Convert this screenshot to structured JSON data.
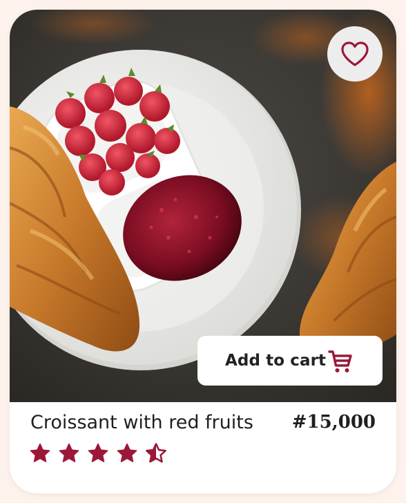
{
  "product": {
    "title": "Croissant with red fruits",
    "price": "#15,000",
    "rating": 4.5,
    "rating_max": 5
  },
  "actions": {
    "add_to_cart_label": "Add to cart"
  },
  "icons": {
    "favorite": "heart-outline-icon",
    "cart": "shopping-cart-icon",
    "star": "star-icon"
  },
  "colors": {
    "accent": "#9b1838",
    "card_background": "#ffffff",
    "page_background": "#fdf3ec",
    "favorite_button": "#ededed"
  }
}
